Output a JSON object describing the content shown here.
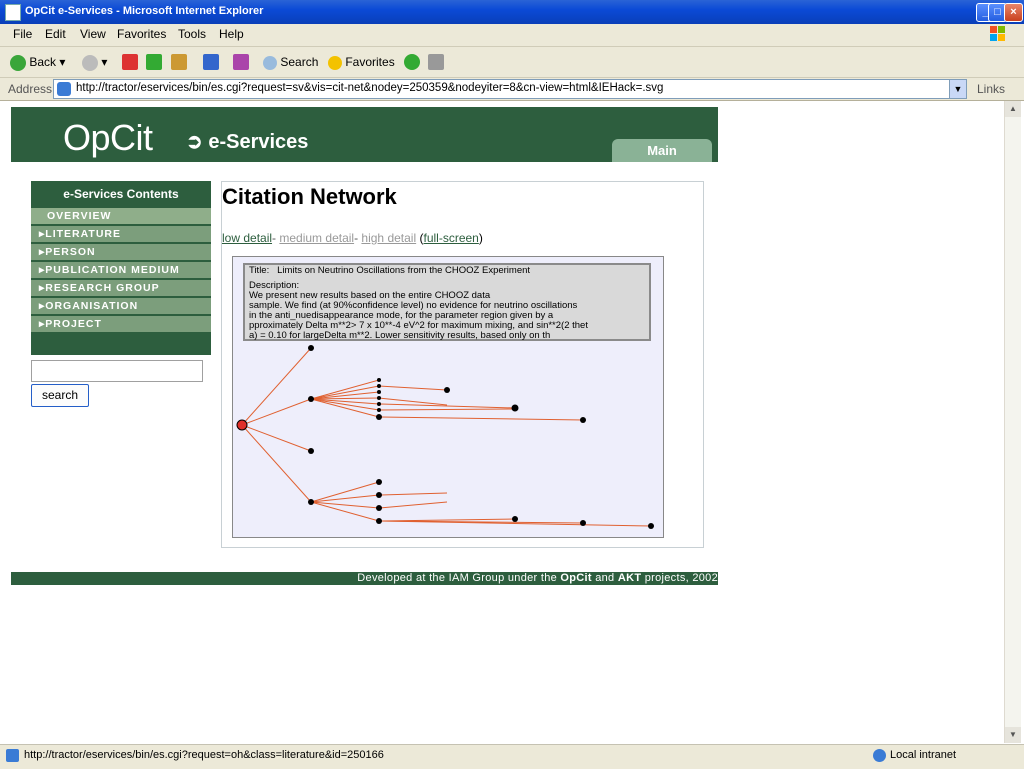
{
  "window": {
    "title": "OpCit e-Services - Microsoft Internet Explorer"
  },
  "menu": {
    "file": "File",
    "edit": "Edit",
    "view": "View",
    "favorites": "Favorites",
    "tools": "Tools",
    "help": "Help"
  },
  "toolbar": {
    "back": "Back",
    "search": "Search",
    "favorites": "Favorites"
  },
  "address": {
    "label": "Address",
    "url": "http://tractor/eservices/bin/es.cgi?request=sv&vis=cit-net&nodey=250359&nodeyiter=8&cn-view=html&IEHack=.svg",
    "links": "Links"
  },
  "page": {
    "logo": "OpCit",
    "subtitle": "e-Services",
    "main_tab": "Main",
    "sidebar": {
      "header": "e-Services Contents",
      "items": [
        "Overview",
        "Literature",
        "Person",
        "Publication Medium",
        "Research Group",
        "Organisation",
        "Project"
      ]
    },
    "search_button": "search",
    "content_title": "Citation Network",
    "details": {
      "low": "low detail",
      "sep1": "- ",
      "medium": "medium detail",
      "sep2": "- ",
      "high": "high detail",
      "open": " (",
      "full": "full-screen",
      "close": ")"
    },
    "info": {
      "title_label": "Title:",
      "title": "Limits on Neutrino Oscillations from the CHOOZ Experiment",
      "description_label": "Description:",
      "desc_lines": [
        "We present new results based on the entire CHOOZ data",
        "sample. We find (at 90%confidence level) no evidence for neutrino oscillations",
        "in the anti_nuedisappearance mode, for the parameter region given by a",
        "pproximately Delta m**2> 7 x 10**-4 eV^2 for maximum mixing, and sin**2(2 thet",
        "a) = 0.10 for largeDelta m**2. Lower sensitivity results, based only on th"
      ]
    },
    "footer": {
      "pre": "Developed at the IAM Group under the ",
      "b1": "OpCit",
      "mid": " and ",
      "b2": "AKT",
      "post": " projects, 2002"
    }
  },
  "status": {
    "text": "http://tractor/eservices/bin/es.cgi?request=oh&class=literature&id=250166",
    "zone": "Local intranet"
  },
  "colors": {
    "header_green": "#2d5e3e",
    "menu_green": "#7c9e7c",
    "edge": "#e06030",
    "root": "#e0302a"
  }
}
